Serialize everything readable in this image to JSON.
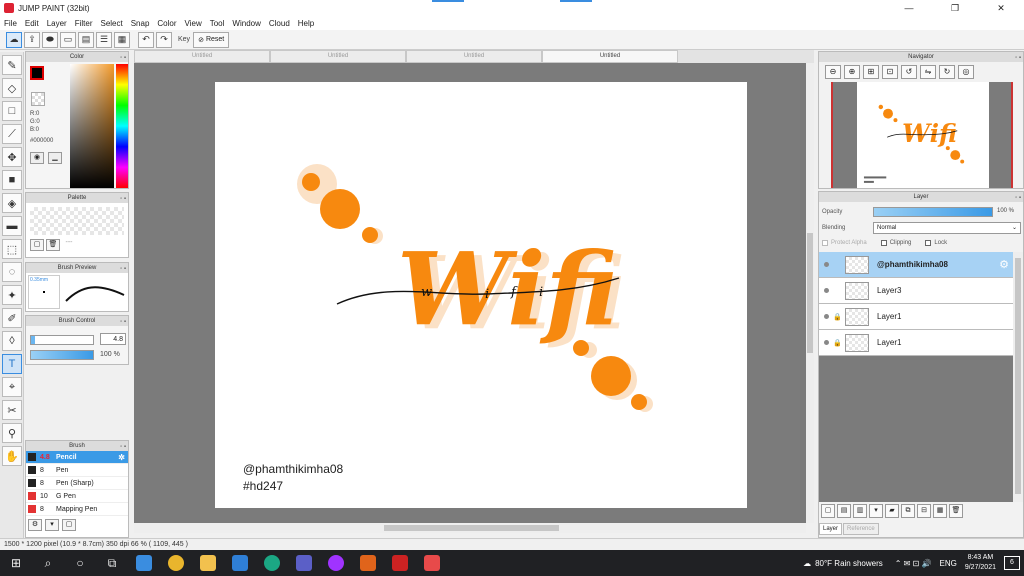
{
  "window": {
    "title": "JUMP PAINT (32bit)",
    "minimize": "—",
    "maximize": "❐",
    "close": "✕"
  },
  "menu": [
    "File",
    "Edit",
    "Layer",
    "Filter",
    "Select",
    "Snap",
    "Color",
    "View",
    "Tool",
    "Window",
    "Cloud",
    "Help"
  ],
  "toolbar": {
    "key_label": "Key",
    "reset_label": "Reset"
  },
  "color_panel": {
    "title": "Color",
    "r": "R:0",
    "g": "G:0",
    "b": "B:0",
    "hex": "#000000"
  },
  "palette_panel": {
    "title": "Palette",
    "extra": "---"
  },
  "brush_preview": {
    "title": "Brush Preview",
    "size": "0.35mm"
  },
  "brush_control": {
    "title": "Brush Control",
    "size": "4.8",
    "opacity": "100 %"
  },
  "brush_panel": {
    "title": "Brush",
    "items": [
      {
        "size": "4.8",
        "name": "Pencil",
        "color": "#222222",
        "selected": true
      },
      {
        "size": "8",
        "name": "Pen",
        "color": "#222222",
        "selected": false
      },
      {
        "size": "8",
        "name": "Pen (Sharp)",
        "color": "#222222",
        "selected": false
      },
      {
        "size": "10",
        "name": "G Pen",
        "color": "#e33333",
        "selected": false
      },
      {
        "size": "8",
        "name": "Mapping Pen",
        "color": "#e33333",
        "selected": false
      }
    ]
  },
  "doc_tabs": [
    "Untitled",
    "Untitled",
    "Untitled",
    "Untitled"
  ],
  "canvas": {
    "lettering": "Wifi",
    "script_letters": [
      "w",
      "i",
      "f",
      "i"
    ],
    "credit_handle": "@phamthikimha08",
    "credit_tag": "#hd247",
    "accent": "#f7890f",
    "shadow": "#fbe1c6"
  },
  "status": "1500 * 1200 pixel   (10.9 * 8.7cm)   350 dpi   66 %   ( 1109, 445 )",
  "navigator": {
    "title": "Navigator"
  },
  "layer_panel": {
    "title": "Layer",
    "opacity_label": "Opacity",
    "opacity_value": "100 %",
    "blending_label": "Blending",
    "blending_value": "Normal",
    "protect_alpha": "Protect Alpha",
    "clipping": "Clipping",
    "lock": "Lock",
    "layers": [
      {
        "name": "@phamthikimha08",
        "selected": true,
        "locked": false
      },
      {
        "name": "Layer3",
        "selected": false,
        "locked": false
      },
      {
        "name": "Layer1",
        "selected": false,
        "locked": true
      },
      {
        "name": "Layer1",
        "selected": false,
        "locked": true
      }
    ],
    "tab_layer": "Layer",
    "tab_reference": "Reference"
  },
  "taskbar": {
    "weather": "80°F  Rain showers",
    "lang": "ENG",
    "time": "8:43 AM",
    "date": "9/27/2021",
    "notifications": "6"
  }
}
